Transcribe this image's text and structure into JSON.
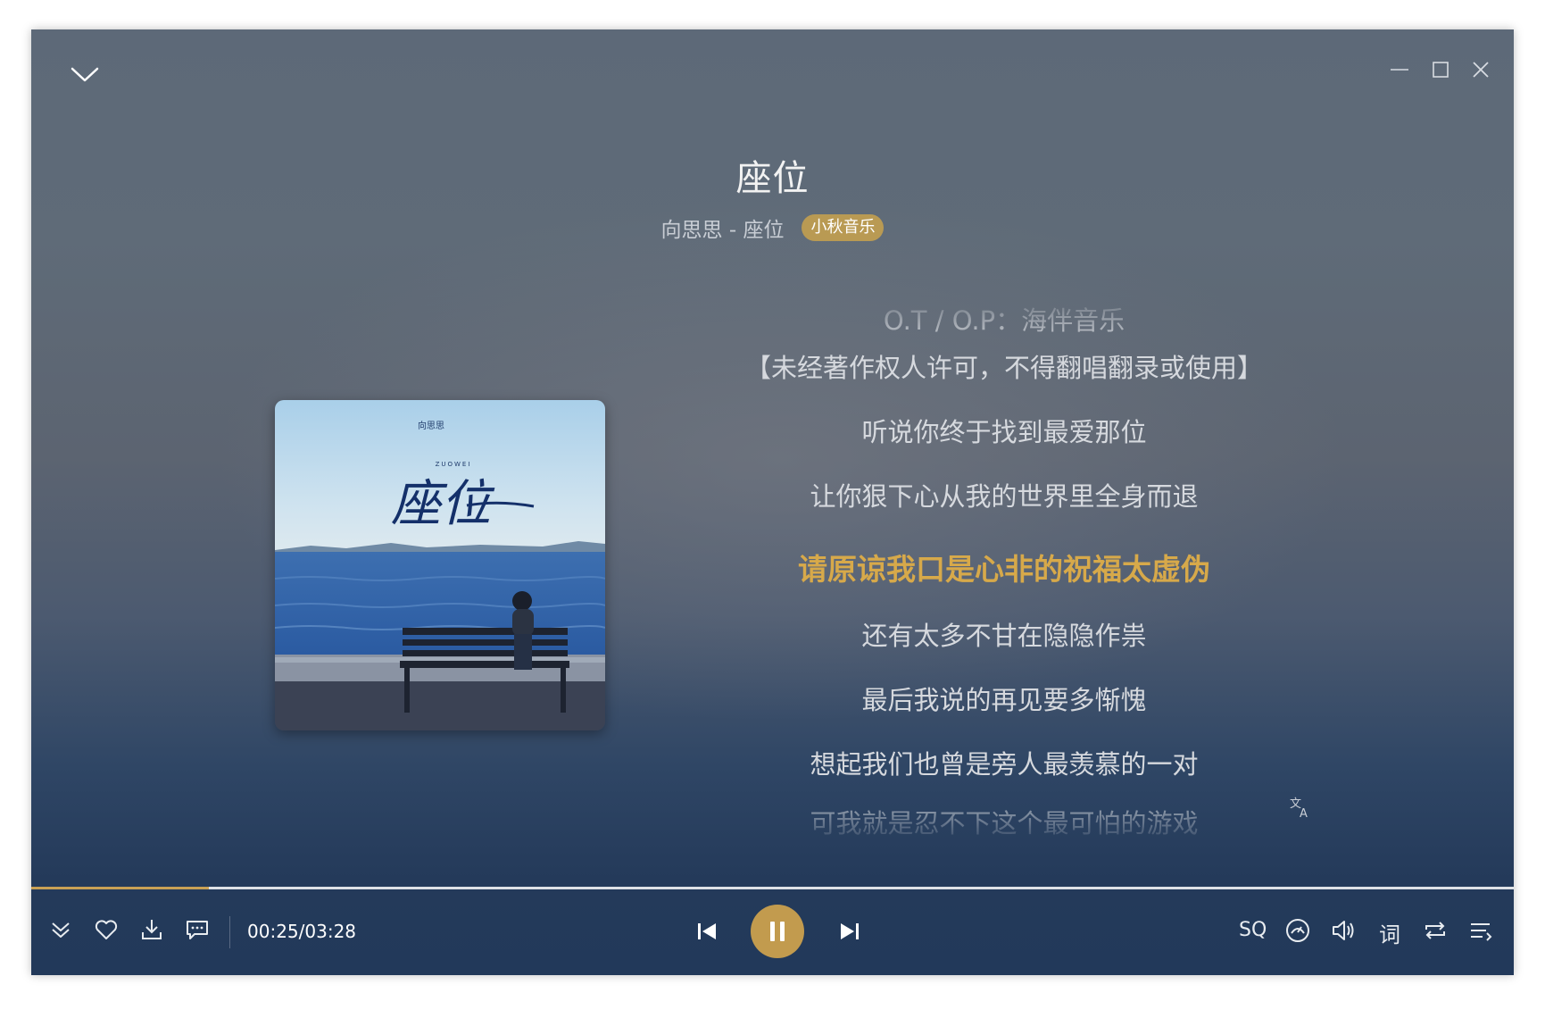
{
  "player": {
    "song_title": "座位",
    "song_subtitle": "向思思 - 座位",
    "quality_badge": "小秋音乐",
    "current_time": "00:25/03:28",
    "progress": 0.12,
    "accent_color": "#c9a155"
  },
  "cover": {
    "artist_text": "向思思",
    "title_pinyin": "ZUOWEI",
    "title_calligraphy": "座位"
  },
  "lyrics": {
    "lines": [
      "O.T / O.P：海伴音乐",
      "【未经著作权人许可，不得翻唱翻录或使用】",
      "听说你终于找到最爱那位",
      "让你狠下心从我的世界里全身而退",
      "请原谅我口是心非的祝福太虚伪",
      "还有太多不甘在隐隐作祟",
      "最后我说的再见要多惭愧",
      "想起我们也曾是旁人最羡慕的一对",
      "可我就是忍不下这个最可怕的游戏"
    ],
    "active_index": 4
  },
  "controls": {
    "sq_label": "SQ",
    "lyrics_label": "词"
  },
  "icons": {
    "collapse": "chevron-down-icon",
    "minimize": "minimize-icon",
    "maximize": "maximize-icon",
    "close": "close-icon",
    "translate": "translate-icon",
    "more": "double-chevron-down-icon",
    "like": "heart-icon",
    "download": "download-icon",
    "comment": "comment-icon",
    "previous": "previous-icon",
    "pause": "pause-icon",
    "next": "next-icon",
    "effects": "sound-effect-icon",
    "volume": "volume-icon",
    "repeat": "repeat-icon",
    "playlist": "playlist-icon"
  }
}
